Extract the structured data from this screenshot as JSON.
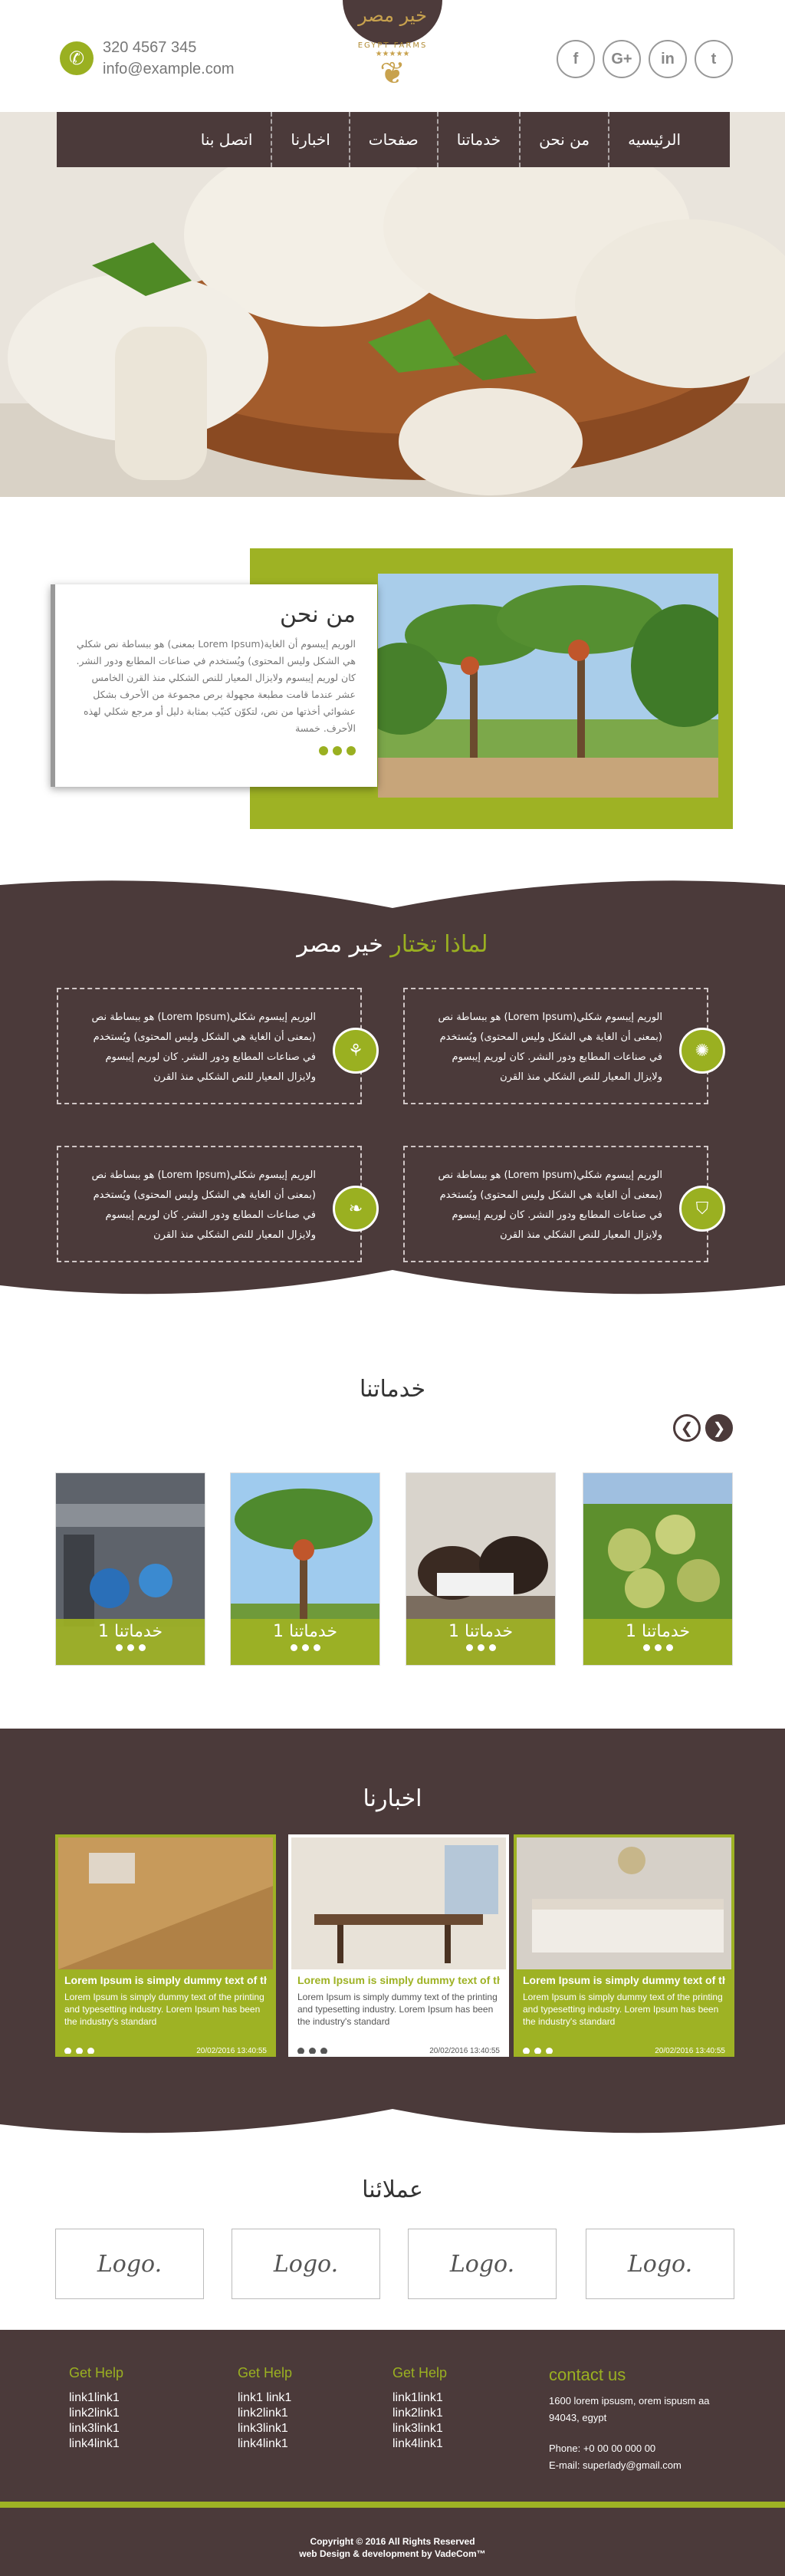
{
  "header": {
    "phone": "320 4567 345",
    "email": "info@example.com",
    "logo_title": "خير مصر",
    "logo_sub": "EGYPT FARMS",
    "social": [
      "f",
      "G+",
      "in",
      "t"
    ]
  },
  "nav": {
    "items": [
      "الرئيسيه",
      "من نحن",
      "خدماتنا",
      "صفحات",
      "اخبارنا",
      "اتصل بنا"
    ]
  },
  "about": {
    "title": "من نحن",
    "text": "هو ببساطة نص شكلي (بمعنى Lorem Ipsum)الوريم إيبسوم أن الغاية هي الشكل وليس المحتوى) ويُستخدم في صناعات المطابع ودور النشر. كان لوريم إيبسوم ولايزال المعيار للنص الشكلي منذ القرن الخامس عشر عندما قامت مطبعة مجهولة برص مجموعة من الأحرف بشكل عشوائي أخذتها من نص، لتكوّن كتيّب بمثابة دليل أو مرجع شكلي لهذه الأحرف. خمسة"
  },
  "why": {
    "title_prefix": "لماذا تختار",
    "title_brand": "خير مصر",
    "item_text": "هو ببساطة نص (Lorem Ipsum)الوريم إيبسوم شكلي (بمعنى أن الغاية هي الشكل وليس المحتوى) ويُستخدم في صناعات المطابع ودور النشر. كان لوريم إيبسوم ولايزال المعيار للنص الشكلي منذ القرن",
    "icons": [
      "sun-icon",
      "wheat-icon",
      "shield-icon",
      "leaf-icon"
    ]
  },
  "services": {
    "title": "خدماتنا",
    "caption": "خدماتنا 1",
    "prev": "❮",
    "next": "❯"
  },
  "news": {
    "title": "اخبارنا",
    "heading": "Lorem Ipsum is simply dummy text of the",
    "text": "Lorem Ipsum is simply dummy text of the printing and typesetting industry. Lorem Ipsum has been the industry's standard",
    "date": "20/02/2016 13:40:55"
  },
  "clients": {
    "title": "عملائنا",
    "logo_text": "Logo."
  },
  "footer": {
    "col_heading": "Get Help",
    "col1": [
      "link1link1",
      "link2link1",
      "link3link1",
      "link4link1"
    ],
    "col2": [
      "link1 link1",
      "link2link1",
      "link3link1",
      "link4link1"
    ],
    "col3": [
      "link1link1",
      "link2link1",
      "link3link1",
      "link4link1"
    ],
    "contact_heading": "contact us",
    "address1": "1600 lorem ipsusm, orem ispusm aa",
    "address2": "94043, egypt",
    "phone": "Phone: +0 00 00 000  00",
    "email": "E-mail: superlady@gmail.com",
    "copyright": "Copyright © 2016 All Rights Reserved",
    "credit": "web Design & development by VadeCom™"
  },
  "colors": {
    "brown": "#4b3a3a",
    "green": "#9eb224"
  }
}
